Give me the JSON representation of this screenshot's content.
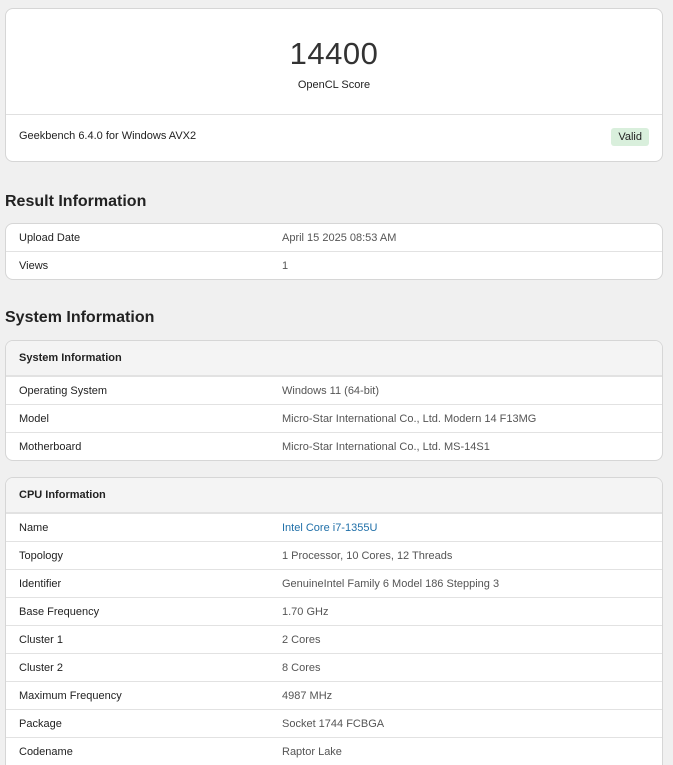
{
  "score": {
    "value": "14400",
    "label": "OpenCL Score",
    "version": "Geekbench 6.4.0 for Windows AVX2",
    "status": "Valid"
  },
  "result_info": {
    "title": "Result Information",
    "rows": [
      {
        "key": "Upload Date",
        "value": "April 15 2025 08:53 AM"
      },
      {
        "key": "Views",
        "value": "1"
      }
    ]
  },
  "system_info": {
    "title": "System Information",
    "card_title": "System Information",
    "rows": [
      {
        "key": "Operating System",
        "value": "Windows 11 (64-bit)"
      },
      {
        "key": "Model",
        "value": "Micro-Star International Co., Ltd. Modern 14 F13MG"
      },
      {
        "key": "Motherboard",
        "value": "Micro-Star International Co., Ltd. MS-14S1"
      }
    ]
  },
  "cpu_info": {
    "card_title": "CPU Information",
    "rows": [
      {
        "key": "Name",
        "value": "Intel Core i7-1355U"
      },
      {
        "key": "Topology",
        "value": "1 Processor, 10 Cores, 12 Threads"
      },
      {
        "key": "Identifier",
        "value": "GenuineIntel Family 6 Model 186 Stepping 3"
      },
      {
        "key": "Base Frequency",
        "value": "1.70 GHz"
      },
      {
        "key": "Cluster 1",
        "value": "2 Cores"
      },
      {
        "key": "Cluster 2",
        "value": "8 Cores"
      },
      {
        "key": "Maximum Frequency",
        "value": "4987 MHz"
      },
      {
        "key": "Package",
        "value": "Socket 1744 FCBGA"
      },
      {
        "key": "Codename",
        "value": "Raptor Lake"
      }
    ]
  },
  "colors": {
    "link": "#1f6fa8",
    "valid_badge_bg": "#d9efdc"
  }
}
